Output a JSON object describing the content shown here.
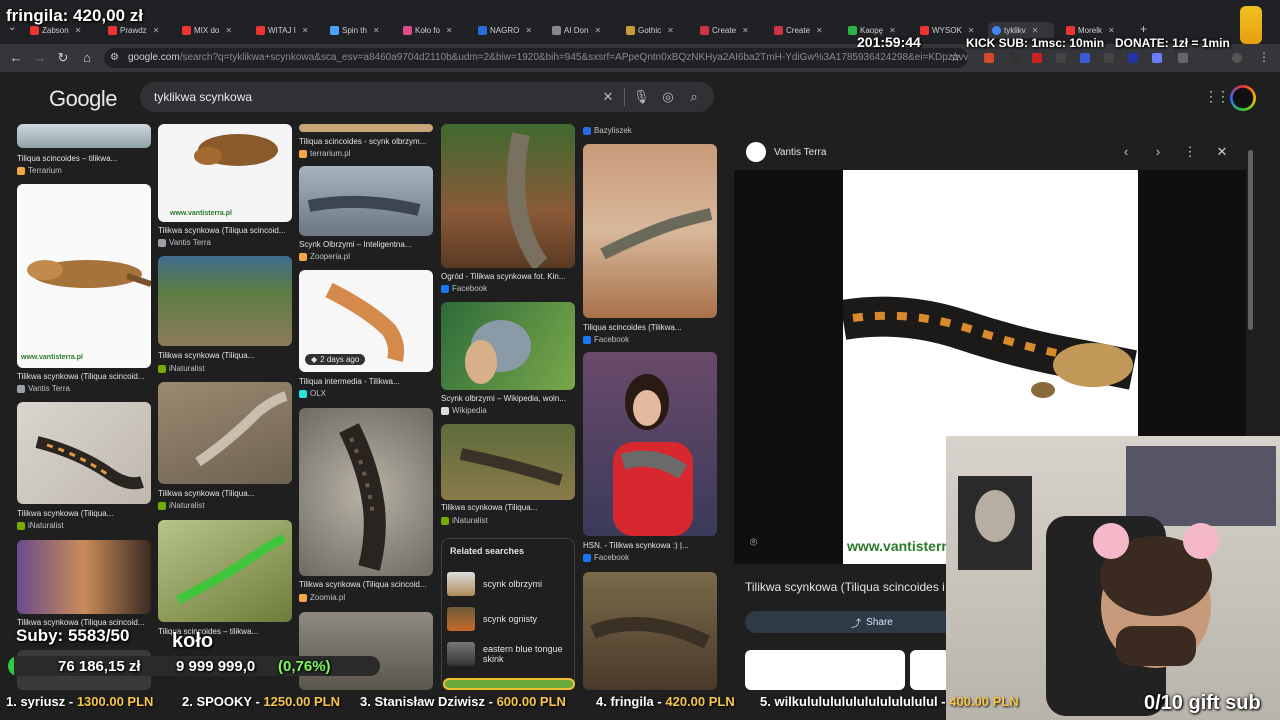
{
  "browser": {
    "tabs": [
      {
        "label": "Zabson",
        "color": "#e33"
      },
      {
        "label": "Prawdz",
        "color": "#e33"
      },
      {
        "label": "MIX do",
        "color": "#e33"
      },
      {
        "label": "WITAJ I",
        "color": "#e33"
      },
      {
        "label": "Spin th",
        "color": "#4aa3ff"
      },
      {
        "label": "Koło fo",
        "color": "#e24a8c"
      },
      {
        "label": "NAGRO",
        "color": "#2a6be0"
      },
      {
        "label": "AI Don",
        "color": "#888"
      },
      {
        "label": "Gothic",
        "color": "#c89a3a"
      },
      {
        "label": "Create",
        "color": "#c34"
      },
      {
        "label": "Create",
        "color": "#c34"
      },
      {
        "label": "Kaopę",
        "color": "#2bb34a"
      },
      {
        "label": "WYSOK",
        "color": "#e33"
      },
      {
        "label": "tyklikv",
        "color": "#4285f4"
      },
      {
        "label": "Morelk",
        "color": "#e33"
      }
    ],
    "url_host": "google.com",
    "url_rest": "/search?q=tyklikwa+scynkowa&sca_esv=a8460a9704d2110b&udm=2&biw=1920&bih=945&sxsrf=APpeQntn0xBQzNKHya2AI6ba2TmH-YdiGw%3A1785936424298&ei=KDpzavvmEFC"
  },
  "google": {
    "logo": "Google",
    "query": "tyklikwa scynkowa"
  },
  "results": [
    {
      "caption": "Tiliqua scincoides – tilikwa...",
      "source": "Terrarium",
      "fav": "#f4a742"
    },
    {
      "caption": "Tilikwa scynkowa (Tiliqua scincoid...",
      "source": "Vantis Terra",
      "fav": "#9aa0a6"
    },
    {
      "caption": "Tilikwa scynkowa (Tiliqua...",
      "source": "iNaturalist",
      "fav": "#74ac00"
    },
    {
      "caption": "Tilikwa scynkowa (Tiliqua scincoid...",
      "source": "",
      "fav": "#9aa0a6"
    },
    {
      "caption": "Tilikwa scynkowa (Tiliqua scincoid...",
      "source": "Vantis Terra",
      "fav": "#9aa0a6"
    },
    {
      "caption": "Tilikwa scynkowa (Tiliqua...",
      "source": "iNaturalist",
      "fav": "#74ac00"
    },
    {
      "caption": "Tilikwa scynkowa (Tiliqua...",
      "source": "iNaturalist",
      "fav": "#74ac00"
    },
    {
      "caption": "Tiliqua scincoides – tilikwa...",
      "source": "",
      "fav": "#f4a742"
    },
    {
      "caption": "Tiliqua scincoides - scynk olbrzym...",
      "source": "terrarium.pl",
      "fav": "#f4a742"
    },
    {
      "caption": "Scynk Olbrzymi – Inteligentna...",
      "source": "Zooperia.pl",
      "fav": "#f4a742"
    },
    {
      "caption": "Tiliqua intermedia - Tilikwa...",
      "source": "OLX",
      "fav": "#23e5db"
    },
    {
      "caption": "Tilikwa scynkowa (Tiliqua scincoid...",
      "source": "Zoomia.pl",
      "fav": "#f4a742"
    },
    {
      "caption": "Ogród - Tilikwa scynkowa fot. Kin...",
      "source": "Facebook",
      "fav": "#1877f2"
    },
    {
      "caption": "Scynk olbrzymi – Wikipedia, woln...",
      "source": "Wikipedia",
      "fav": "#dddddd"
    },
    {
      "caption": "Tilikwa scynkowa (Tiliqua...",
      "source": "iNaturalist",
      "fav": "#74ac00"
    },
    {
      "caption": "",
      "source": "Bazyliszek",
      "fav": "#2a6be0"
    },
    {
      "caption": "Tiliqua scincoides (Tilikwa...",
      "source": "Facebook",
      "fav": "#1877f2"
    },
    {
      "caption": "HSN. - Tilikwa scynkowa :) |...",
      "source": "Facebook",
      "fav": "#1877f2"
    }
  ],
  "badge_2days": "2 days ago",
  "related": {
    "title": "Related searches",
    "items": [
      "scynk olbrzymi",
      "scynk ognisty",
      "eastern blue tongue skink"
    ]
  },
  "preview": {
    "site": "Vantis Terra",
    "title": "Tilikwa scynkowa (Tiliqua scincoides i",
    "share": "Share",
    "watermark": "www.vantisterra.pl",
    "watermark_small": "www.vantisterra.pl"
  },
  "stream": {
    "user": "fringila: 420,00 zł",
    "timer": "201:59:44",
    "kick": "KICK SUB: 1msc: 10min",
    "donate": "DONATE: 1zł = 1min",
    "subs": "Suby: 5583/50",
    "kolo": "koło",
    "amount_left": "76 186,15 zł",
    "amount_right": "9 999 999,0",
    "percent": "(0,76%)",
    "gift": "0/10 gift sub",
    "ticker": [
      {
        "name": "1. syriusz",
        "amt": "1300.00 PLN"
      },
      {
        "name": "2. SPOOKY",
        "amt": "1250.00 PLN"
      },
      {
        "name": "3. Stanisław Dziwisz",
        "amt": "600.00 PLN"
      },
      {
        "name": "4. fringila",
        "amt": "420.00 PLN"
      },
      {
        "name": "5. wilkulululululululululululul",
        "amt": "400.00 PLN"
      }
    ]
  }
}
